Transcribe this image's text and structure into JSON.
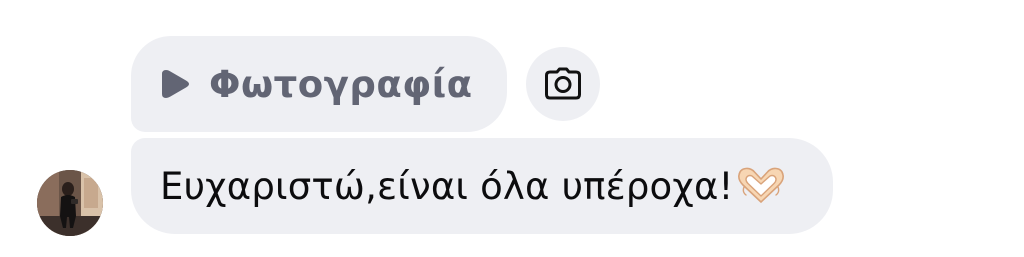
{
  "conversation": {
    "attachment": {
      "icon": "play-icon",
      "label": "Φωτογραφία",
      "text_color": "#626574",
      "bubble_color": "#eeeff3"
    },
    "camera_button": {
      "icon": "camera-icon"
    },
    "message": {
      "text": "Ευχαριστώ,είναι όλα υπέροχα!",
      "emoji": "heart-hands-icon",
      "text_color": "#0c0c0e"
    },
    "sender": {
      "avatar": "avatar"
    }
  }
}
